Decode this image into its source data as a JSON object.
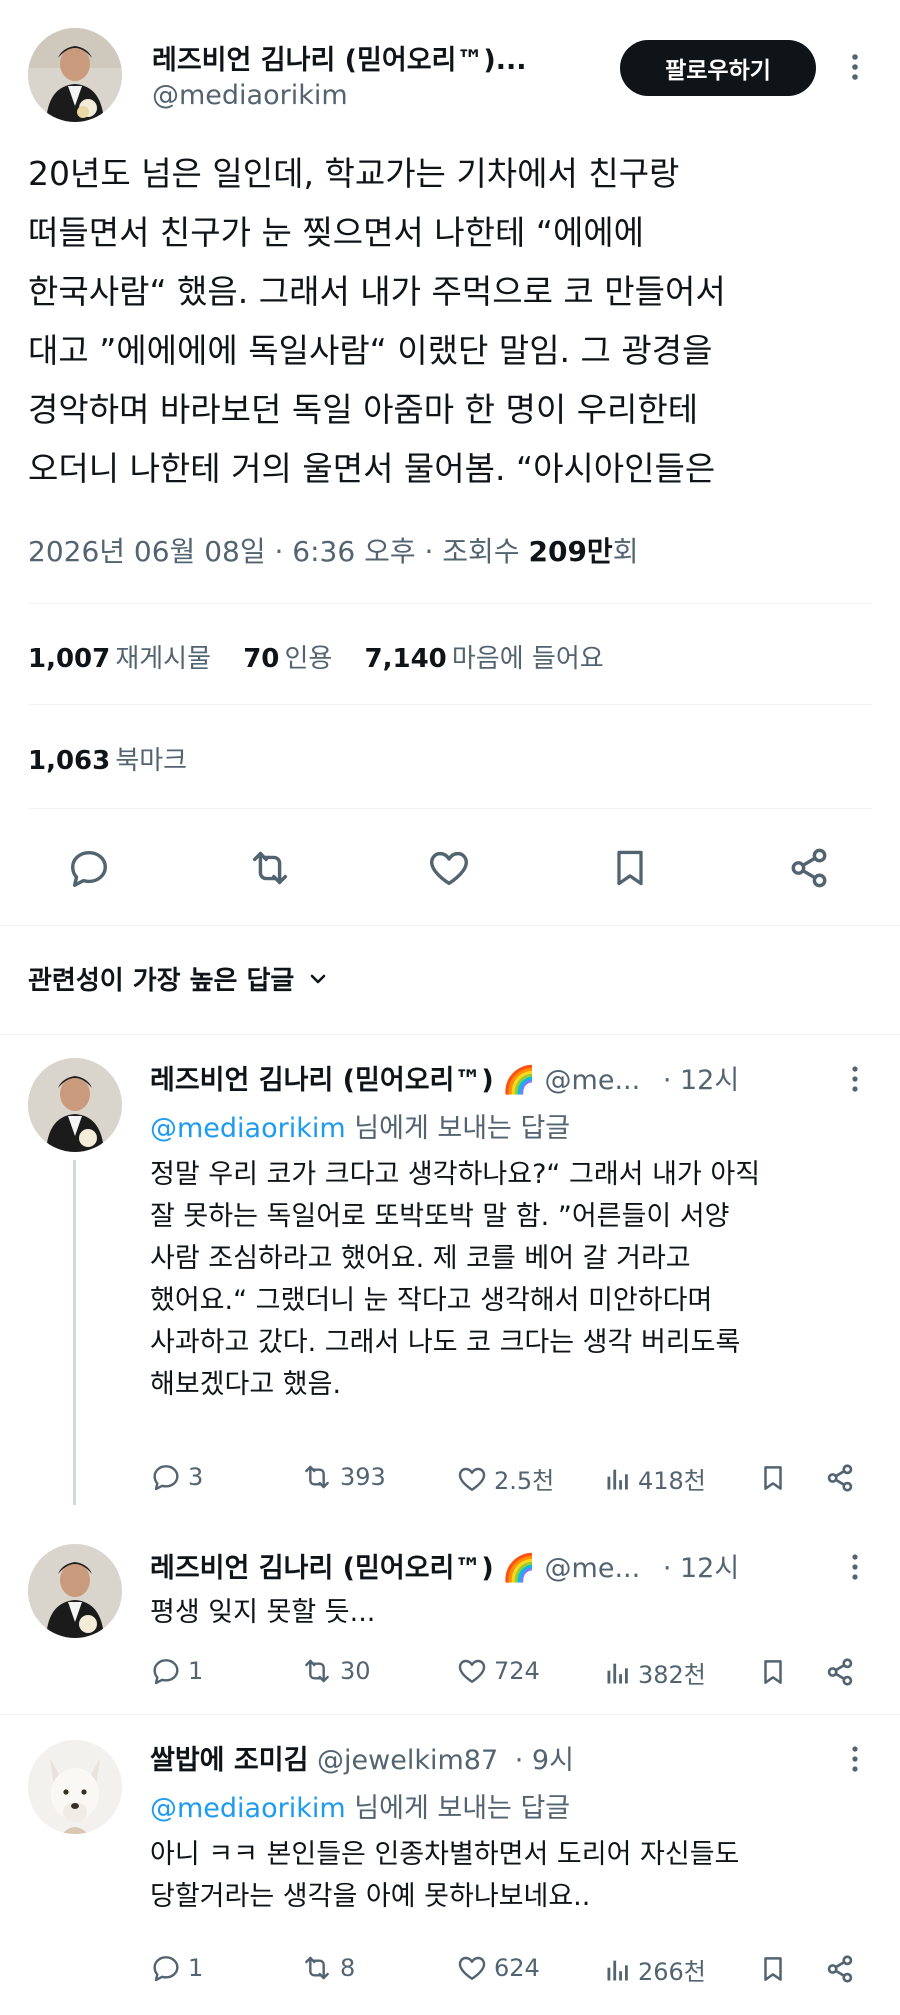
{
  "main_tweet": {
    "display_name": "레즈비언 김나리 (믿어오리™)...",
    "handle": "@mediaorikim",
    "follow_label": "팔로우하기",
    "body": "20년도 넘은 일인데, 학교가는 기차에서 친구랑\n떠들면서 친구가 눈 찢으면서 나한테 “에에에\n한국사람“ 했음. 그래서 내가 주먹으로 코 만들어서\n대고 ”에에에에 독일사람“ 이랬단 말임. 그 광경을\n경악하며 바라보던 독일 아줌마 한 명이 우리한테\n오더니 나한테 거의 울면서 물어봄. “아시아인들은",
    "timestamp": "2026년 06월 08일 · 6:36 오후 · 조회수",
    "views_number": "209만",
    "views_suffix": "회",
    "stats": {
      "retweets_num": "1,007",
      "retweets_label": "재게시물",
      "quotes_num": "70",
      "quotes_label": "인용",
      "likes_num": "7,140",
      "likes_label": "마음에 들어요",
      "bookmarks_num": "1,063",
      "bookmarks_label": "북마크"
    },
    "actions": [
      "reply-icon",
      "retweet-icon",
      "heart-icon",
      "bookmark-icon",
      "share-icon"
    ]
  },
  "sort": {
    "label": "관련성이 가장 높은 답글"
  },
  "replies": [
    {
      "name": "레즈비언 김나리 (믿어오리™)",
      "emoji": "🌈",
      "handle": "@me...",
      "time": "· 12시",
      "reply_to_handle": "@mediaorikim",
      "reply_to_suffix": "님에게 보내는 답글",
      "text": "정말 우리 코가 크다고 생각하나요?“ 그래서 내가 아직\n잘 못하는 독일어로 또박또박 말 함. ”어른들이 서양\n사람 조심하라고 했어요. 제 코를 베어 갈 거라고\n했어요.“ 그랬더니 눈 작다고 생각해서 미안하다며\n사과하고 갔다. 그래서 나도 코 크다는 생각 버리도록\n해보겠다고 했음.",
      "replies": "3",
      "retweets": "393",
      "likes": "2.5천",
      "views": "418천"
    },
    {
      "name": "레즈비언 김나리 (믿어오리™)",
      "emoji": "🌈",
      "handle": "@me...",
      "time": "· 12시",
      "text": "평생 잊지 못할 듯...",
      "replies": "1",
      "retweets": "30",
      "likes": "724",
      "views": "382천"
    },
    {
      "name": "쌀밥에 조미김",
      "handle": "@jewelkim87",
      "time": "· 9시",
      "reply_to_handle": "@mediaorikim",
      "reply_to_suffix": "님에게 보내는 답글",
      "text": "아니 ㅋㅋ 본인들은 인종차별하면서 도리어 자신들도\n당할거라는 생각을 아예 못하나보네요..",
      "replies": "1",
      "retweets": "8",
      "likes": "624",
      "views": "266천"
    }
  ],
  "colors": {
    "link": "#1d9bf0",
    "muted": "#536471",
    "text": "#0f1419",
    "button": "#0f1419",
    "divider": "#eff3f4"
  }
}
